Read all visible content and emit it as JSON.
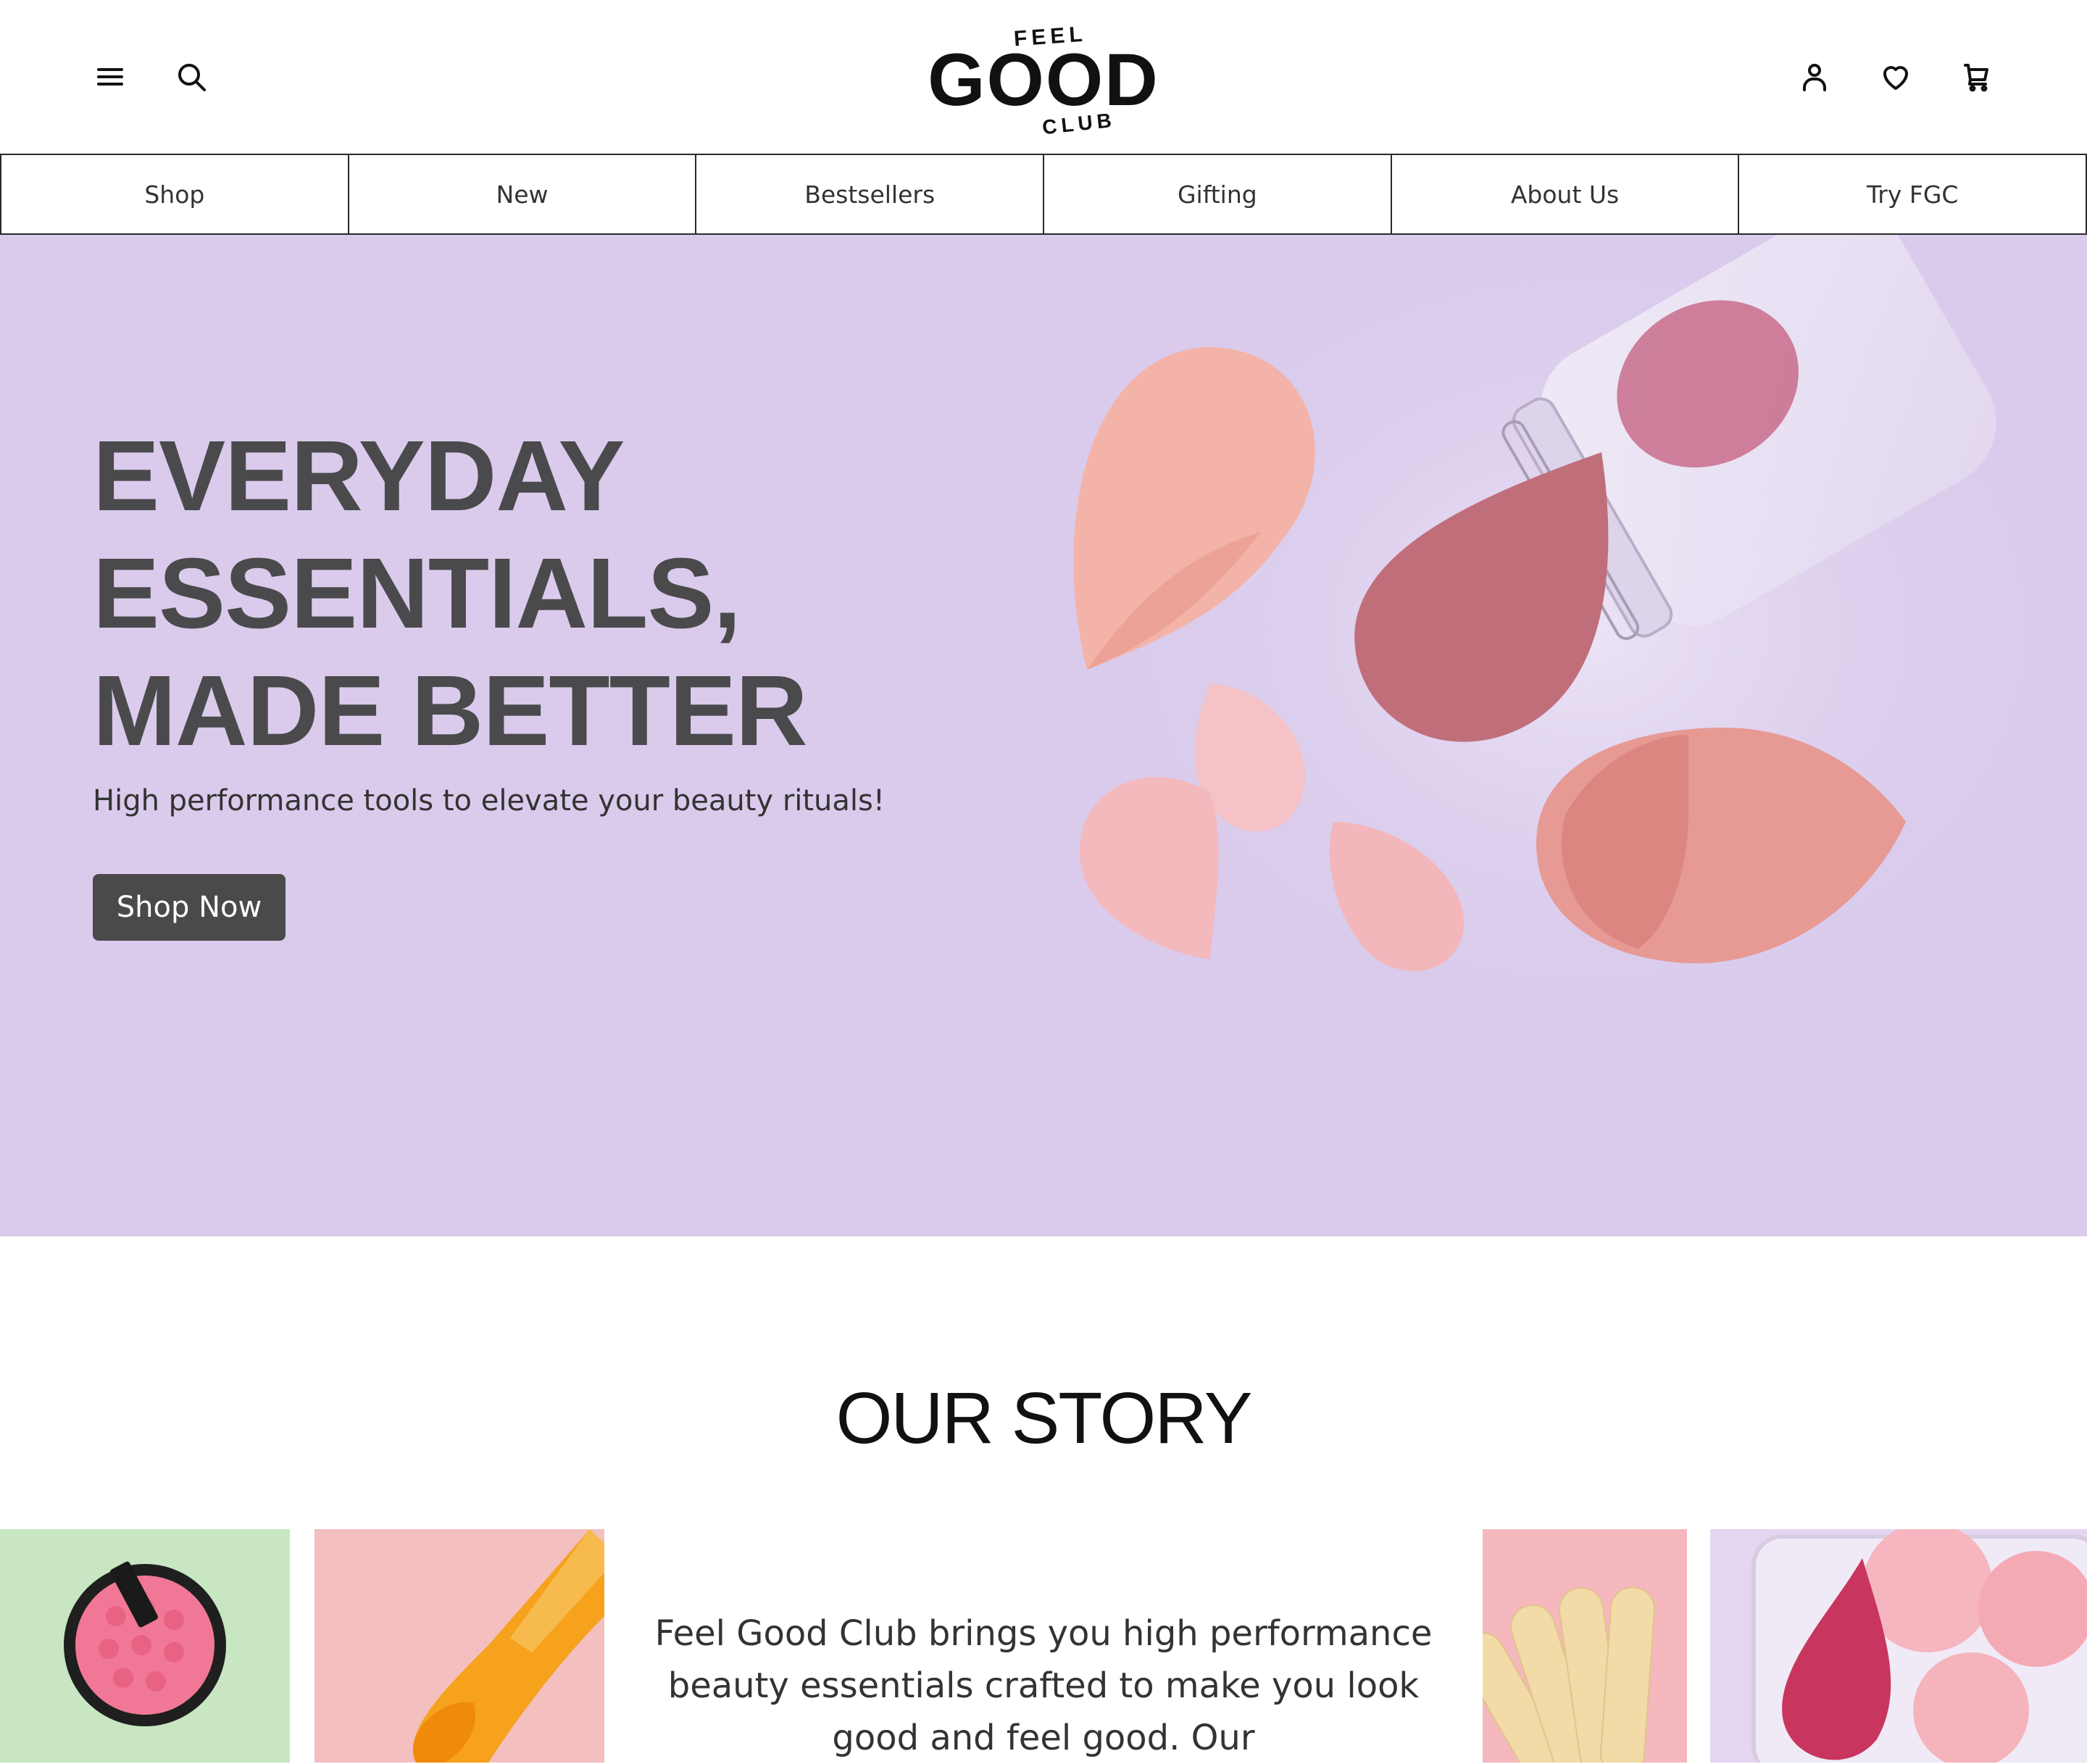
{
  "brand": {
    "logo_top": "FEEL",
    "logo_main": "GOOD",
    "logo_bottom": "CLUB"
  },
  "header": {
    "icons": [
      "menu-icon",
      "search-icon",
      "account-icon",
      "heart-icon",
      "cart-icon"
    ]
  },
  "nav": {
    "items": [
      "Shop",
      "New",
      "Bestsellers",
      "Gifting",
      "About Us",
      "Try FGC"
    ]
  },
  "hero": {
    "title_lines": [
      "EVERYDAY",
      "ESSENTIALS,",
      "MADE BETTER"
    ],
    "subtitle": "High performance tools to elevate your beauty rituals!",
    "cta_label": "Shop Now",
    "background": "#dacbec"
  },
  "story": {
    "title": "OUR STORY",
    "text": "Feel Good Club brings you high performance beauty essentials crafted to make you look good and feel good. Our",
    "tile_colors": [
      "#c9e6c3",
      "#f3bfbf",
      "#f4b8be",
      "#e4d6f1"
    ]
  },
  "colors": {
    "accent_dark": "#4a4a4a",
    "text": "#333333"
  }
}
